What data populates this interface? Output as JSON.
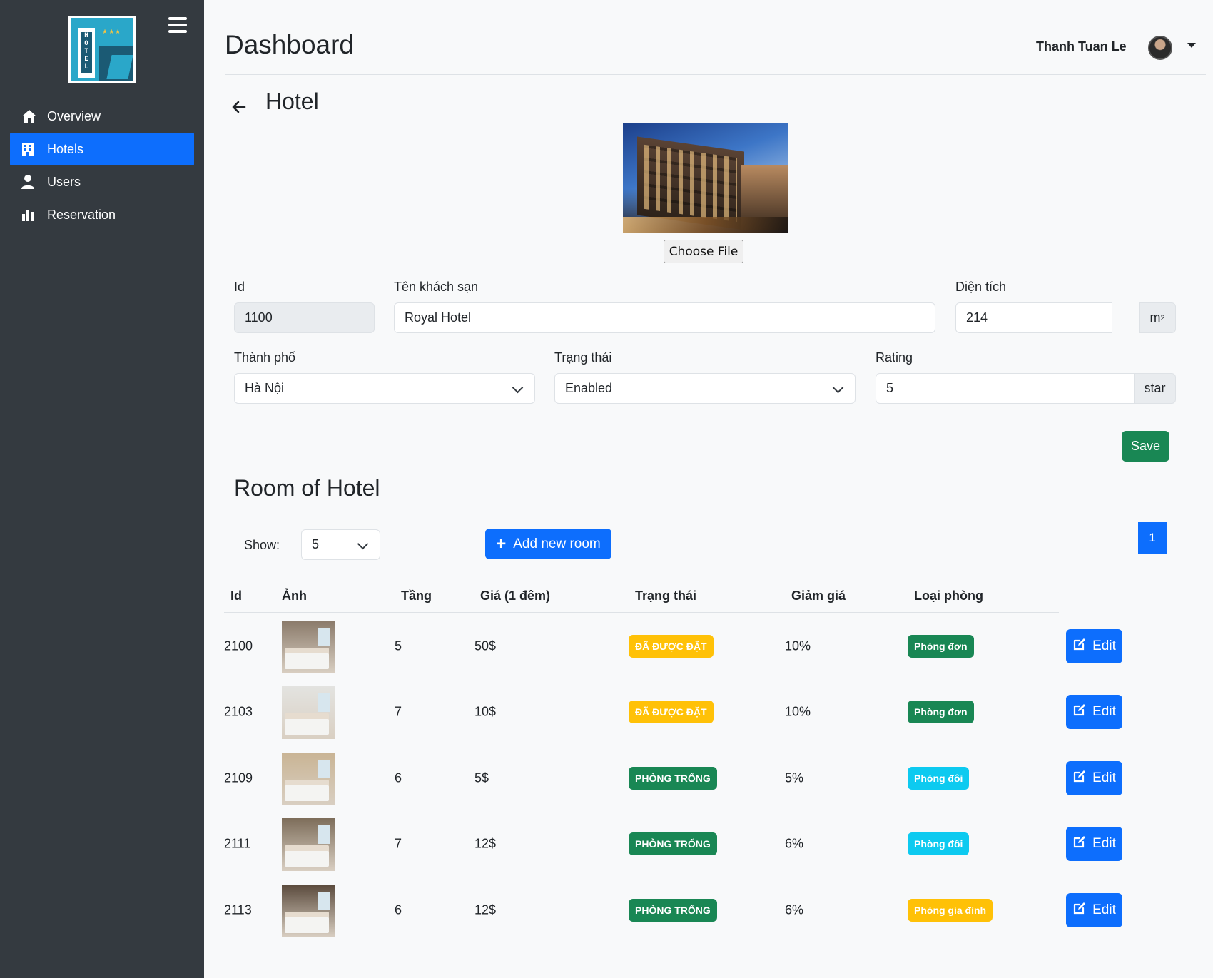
{
  "sidebar": {
    "logo_text": "HOTEL",
    "items": [
      {
        "label": "Overview",
        "icon": "home-icon",
        "active": false
      },
      {
        "label": "Hotels",
        "icon": "building-icon",
        "active": true
      },
      {
        "label": "Users",
        "icon": "user-icon",
        "active": false
      },
      {
        "label": "Reservation",
        "icon": "bar-chart-icon",
        "active": false
      }
    ]
  },
  "header": {
    "title": "Dashboard",
    "user_name": "Thanh Tuan Le"
  },
  "hotel": {
    "section_title": "Hotel",
    "choose_file_label": "Choose File",
    "fields": {
      "id": {
        "label": "Id",
        "value": "1100"
      },
      "name": {
        "label": "Tên khách sạn",
        "value": "Royal Hotel"
      },
      "area": {
        "label": "Diện tích",
        "value": "214",
        "unit_base": "m",
        "unit_sup": "2"
      },
      "city": {
        "label": "Thành phố",
        "value": "Hà Nội"
      },
      "status": {
        "label": "Trạng thái",
        "value": "Enabled"
      },
      "rating": {
        "label": "Rating",
        "value": "5",
        "unit": "star"
      }
    },
    "save_label": "Save"
  },
  "rooms": {
    "title": "Room of Hotel",
    "show_label": "Show:",
    "show_value": "5",
    "add_label": "Add new room",
    "current_page": "1",
    "columns": [
      "Id",
      "Ảnh",
      "Tầng",
      "Giá (1 đêm)",
      "Trạng thái",
      "Giảm giá",
      "Loại phòng"
    ],
    "edit_label": "Edit",
    "rows": [
      {
        "id": "2100",
        "floor": "5",
        "price": "50$",
        "status": "ĐÃ ĐƯỢC ĐẶT",
        "status_type": "warn",
        "discount": "10%",
        "type": "Phòng đơn",
        "type_style": "success"
      },
      {
        "id": "2103",
        "floor": "7",
        "price": "10$",
        "status": "ĐÃ ĐƯỢC ĐẶT",
        "status_type": "warn",
        "discount": "10%",
        "type": "Phòng đơn",
        "type_style": "success"
      },
      {
        "id": "2109",
        "floor": "6",
        "price": "5$",
        "status": "PHÒNG TRỐNG",
        "status_type": "success",
        "discount": "5%",
        "type": "Phòng đôi",
        "type_style": "info"
      },
      {
        "id": "2111",
        "floor": "7",
        "price": "12$",
        "status": "PHÒNG TRỐNG",
        "status_type": "success",
        "discount": "6%",
        "type": "Phòng đôi",
        "type_style": "info"
      },
      {
        "id": "2113",
        "floor": "6",
        "price": "12$",
        "status": "PHÒNG TRỐNG",
        "status_type": "success",
        "discount": "6%",
        "type": "Phòng gia đình",
        "type_style": "warn"
      }
    ]
  },
  "colors": {
    "primary": "#0d6efd",
    "success": "#198754",
    "warning": "#ffc107",
    "info": "#0dcaf0",
    "sidebar": "#343a40"
  }
}
